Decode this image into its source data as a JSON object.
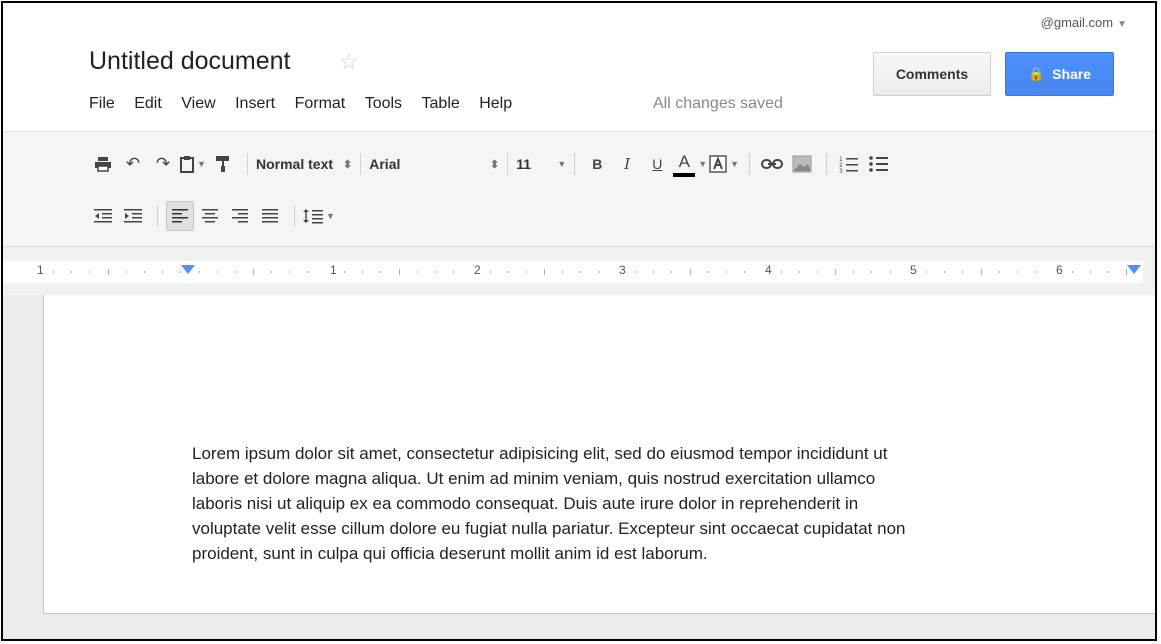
{
  "account": {
    "email": "@gmail.com"
  },
  "doc": {
    "title": "Untitled document",
    "save_status": "All changes saved"
  },
  "menu": [
    "File",
    "Edit",
    "View",
    "Insert",
    "Format",
    "Tools",
    "Table",
    "Help"
  ],
  "buttons": {
    "comments": "Comments",
    "share": "Share"
  },
  "toolbar": {
    "style": "Normal text",
    "font": "Arial",
    "size": "11",
    "bold": "B",
    "italic": "I",
    "underline": "U",
    "text_color": "A"
  },
  "ruler": {
    "labels": [
      "1",
      "1",
      "2",
      "3",
      "4",
      "5",
      "6"
    ]
  },
  "body": {
    "lines": [
      "Lorem ipsum dolor sit amet, consectetur adipisicing elit, sed do eiusmod tempor incididunt ut",
      "labore et dolore magna aliqua. Ut enim ad minim veniam, quis nostrud exercitation ullamco",
      "laboris nisi ut aliquip ex ea commodo consequat. Duis aute irure dolor in reprehenderit in",
      "voluptate velit esse cillum dolore eu fugiat nulla pariatur. Excepteur sint occaecat cupidatat non",
      "proident, sunt in culpa qui officia deserunt mollit anim id est laborum."
    ]
  },
  "colors": {
    "share_blue": "#4d90fe",
    "toolbar_bg": "#f5f5f5",
    "saved_gray": "#888888"
  }
}
